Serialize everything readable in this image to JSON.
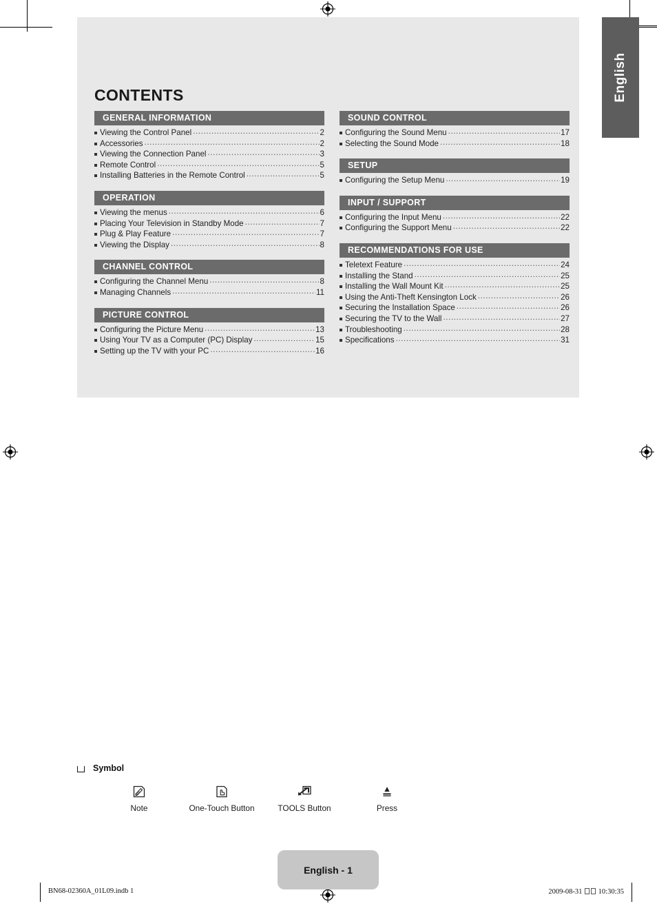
{
  "language_tab": {
    "label": "English"
  },
  "page_title": "CONTENTS",
  "columns": [
    {
      "sections": [
        {
          "heading": "GENERAL INFORMATION",
          "entries": [
            {
              "label": "Viewing the Control Panel",
              "page": "2"
            },
            {
              "label": "Accessories",
              "page": "2"
            },
            {
              "label": "Viewing the Connection Panel",
              "page": "3"
            },
            {
              "label": "Remote Control",
              "page": "5"
            },
            {
              "label": "Installing Batteries in the Remote Control",
              "page": "5"
            }
          ]
        },
        {
          "heading": "OPERATION",
          "entries": [
            {
              "label": "Viewing the menus",
              "page": "6"
            },
            {
              "label": "Placing Your Television in Standby Mode",
              "page": "7"
            },
            {
              "label": "Plug & Play Feature",
              "page": "7"
            },
            {
              "label": "Viewing the Display",
              "page": "8"
            }
          ]
        },
        {
          "heading": "CHANNEL CONTROL",
          "entries": [
            {
              "label": "Configuring the Channel Menu",
              "page": "8"
            },
            {
              "label": "Managing Channels",
              "page": "11"
            }
          ]
        },
        {
          "heading": "PICTURE CONTROL",
          "entries": [
            {
              "label": "Configuring the Picture Menu",
              "page": "13"
            },
            {
              "label": "Using Your TV as a Computer (PC) Display",
              "page": "15"
            },
            {
              "label": "Setting up the TV with your PC",
              "page": "16"
            }
          ]
        }
      ]
    },
    {
      "sections": [
        {
          "heading": "SOUND CONTROL",
          "entries": [
            {
              "label": "Configuring the Sound Menu",
              "page": "17"
            },
            {
              "label": "Selecting the Sound Mode",
              "page": "18"
            }
          ]
        },
        {
          "heading": "SETUP",
          "entries": [
            {
              "label": "Configuring the Setup Menu",
              "page": "19"
            }
          ]
        },
        {
          "heading": "INPUT / SUPPORT",
          "entries": [
            {
              "label": "Configuring the Input Menu",
              "page": "22"
            },
            {
              "label": "Configuring the Support Menu",
              "page": "22"
            }
          ]
        },
        {
          "heading": "RECOMMENDATIONS FOR USE",
          "entries": [
            {
              "label": "Teletext Feature",
              "page": "24"
            },
            {
              "label": "Installing the Stand",
              "page": "25"
            },
            {
              "label": "Installing the Wall Mount Kit",
              "page": "25"
            },
            {
              "label": "Using the Anti-Theft Kensington Lock",
              "page": "26"
            },
            {
              "label": "Securing the Installation Space",
              "page": "26"
            },
            {
              "label": "Securing the TV to the Wall",
              "page": "27"
            },
            {
              "label": "Troubleshooting",
              "page": "28"
            },
            {
              "label": "Specifications",
              "page": "31"
            }
          ]
        }
      ]
    }
  ],
  "symbol": {
    "heading": "Symbol",
    "items": [
      {
        "icon": "note-pencil-icon",
        "label": "Note"
      },
      {
        "icon": "one-touch-button-icon",
        "label": "One-Touch Button"
      },
      {
        "icon": "tools-button-icon",
        "label": "TOOLS Button"
      },
      {
        "icon": "press-arrow-icon",
        "label": "Press"
      }
    ]
  },
  "footer": {
    "page_badge": "English - 1",
    "file_name": "BN68-02360A_01L09.indb   1",
    "date": "2009-08-31",
    "time": "10:30:35"
  },
  "colors": {
    "panel_bg": "#e8e8e8",
    "section_heading_bg": "#6b6b6b",
    "language_tab_bg": "#5d5d5d",
    "page_badge_bg": "#c6c6c6"
  }
}
